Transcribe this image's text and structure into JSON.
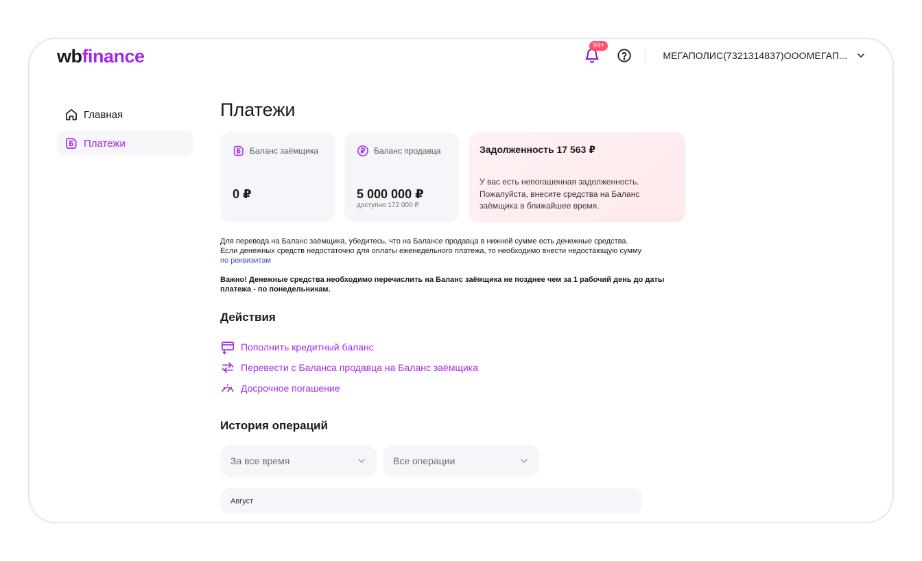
{
  "header": {
    "logo_wb": "wb",
    "logo_finance": "finance",
    "notifications_badge": "99+",
    "company": "МЕГАПОЛИС(7321314837)ООOМЕГАП..."
  },
  "sidebar": {
    "items": [
      {
        "label": "Главная",
        "icon": "home-icon",
        "active": false
      },
      {
        "label": "Платежи",
        "icon": "payments-icon",
        "active": true
      }
    ]
  },
  "main": {
    "title": "Платежи",
    "cards": {
      "borrower": {
        "title": "Баланс заёмщика",
        "amount": "0 ₽"
      },
      "seller": {
        "title": "Баланс продавца",
        "amount": "5 000 000 ₽",
        "available": "доступно 172 000 ₽"
      },
      "debt": {
        "title": "Задолженность 17 563 ₽",
        "text": "У вас есть непогашенная задолженность. Пожалуйста, внесите средства на Баланс заёмщика в ближайшее  время."
      }
    },
    "info": {
      "line1": "Для перевода на Баланс заёмщика, убедитесь, что на Балансе продавца в нижней сумме есть денежные средства.",
      "line2": "Если денежных средств недостаточно для оплаты еженедельного платежа, то необходимо внести недостающую сумму",
      "link": "по реквизитам",
      "warning": "Важно! Денежные средства необходимо перечислить на Баланс заёмщика не позднее чем за 1 рабочий день до даты платежа - по понедельникам."
    },
    "actions": {
      "title": "Действия",
      "items": [
        {
          "label": "Пополнить кредитный баланс",
          "icon": "card-icon"
        },
        {
          "label": "Перевести с Баланса продавца на Баланс заёмщика",
          "icon": "transfer-icon"
        },
        {
          "label": "Досрочное погашение",
          "icon": "speedometer-icon"
        }
      ]
    },
    "history": {
      "title": "История операций",
      "period_filter": "За все время",
      "type_filter": "Все операции",
      "month": "Август"
    }
  },
  "colors": {
    "accent": "#a12ae8",
    "link": "#3d4fb8",
    "badge": "#ff4d6d",
    "card_bg": "#f6f5f9",
    "debt_bg": "#ffeef1"
  }
}
